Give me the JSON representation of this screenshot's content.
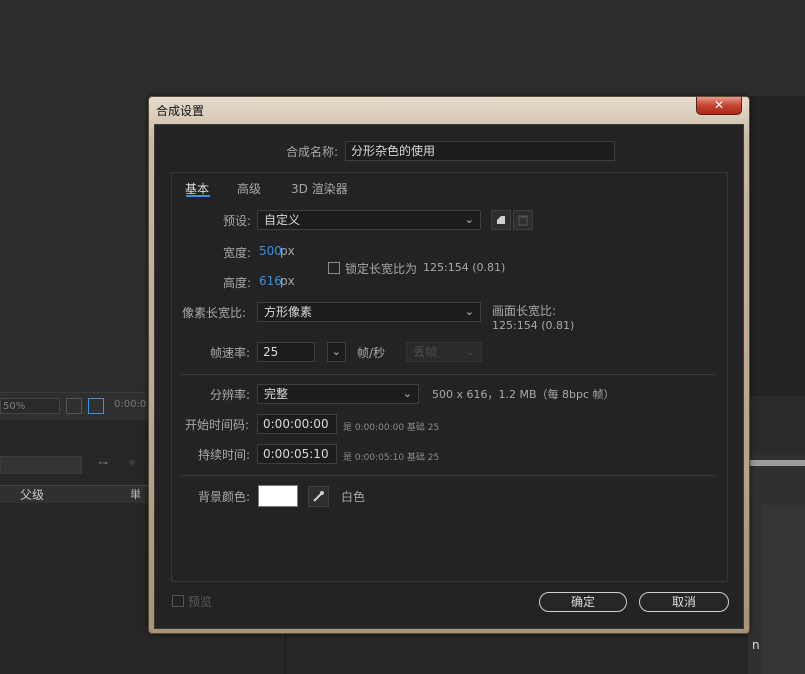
{
  "background": {
    "zoom": "50%",
    "timecode": "0:00:0",
    "column_header": "父级",
    "column_header_sep": "単",
    "right_mark": "n"
  },
  "dialog": {
    "title": "合成设置",
    "close_symbol": "✕",
    "comp_name_label": "合成名称:",
    "comp_name_value": "分形杂色的使用",
    "tabs": [
      "基本",
      "高级",
      "3D 渲染器"
    ],
    "preset_label": "预设:",
    "preset_value": "自定义",
    "width_label": "宽度:",
    "width_value": "500",
    "height_label": "高度:",
    "height_value": "616",
    "px_unit": "px",
    "lock_ratio_label": "锁定长宽比为",
    "lock_ratio_value": "125:154 (0.81)",
    "pixel_aspect_label": "像素长宽比:",
    "pixel_aspect_value": "方形像素",
    "frame_aspect_label": "画面长宽比:",
    "frame_aspect_value": "125:154 (0.81)",
    "frame_rate_label": "帧速率:",
    "frame_rate_value": "25",
    "fps_label": "帧/秒",
    "drop_frame_value": "丢帧",
    "resolution_label": "分辨率:",
    "resolution_value": "完整",
    "resolution_info": "500 x 616，1.2 MB（每 8bpc 帧）",
    "start_tc_label": "开始时间码:",
    "start_tc_value": "0:00:00:00",
    "start_tc_info": "是 0:00:00:00  基础 25",
    "duration_label": "持续时间:",
    "duration_value": "0:00:05:10",
    "duration_info": "是 0:00:05:10  基础 25",
    "bg_color_label": "背景颜色:",
    "bg_color_name": "白色",
    "bg_color_hex": "#ffffff",
    "preview_label": "预览",
    "ok_label": "确定",
    "cancel_label": "取消"
  },
  "colors": {
    "accent": "#3d8fe0",
    "dialog_bg": "#232323",
    "close_button": "#c74431"
  }
}
